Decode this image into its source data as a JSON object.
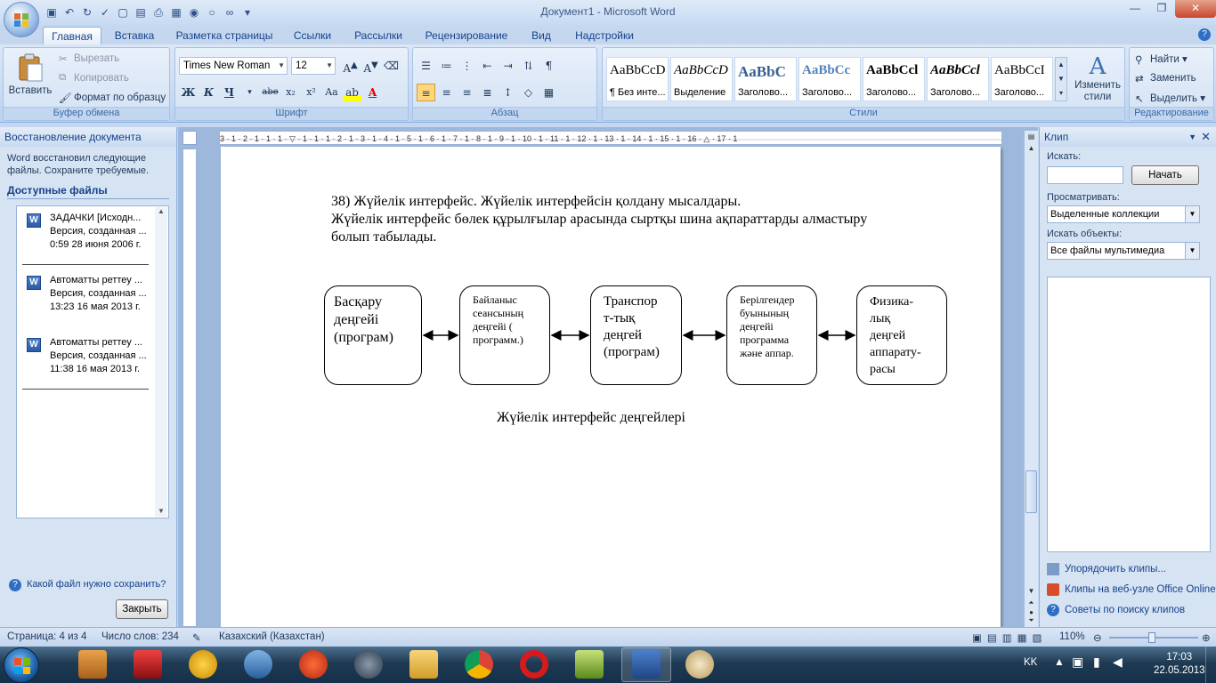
{
  "window": {
    "title": "Документ1 - Microsoft Word"
  },
  "tabs": [
    "Главная",
    "Вставка",
    "Разметка страницы",
    "Ссылки",
    "Рассылки",
    "Рецензирование",
    "Вид",
    "Надстройки"
  ],
  "ribbon": {
    "clipboard": {
      "paste": "Вставить",
      "cut": "Вырезать",
      "copy": "Копировать",
      "format_painter": "Формат по образцу",
      "label": "Буфер обмена"
    },
    "font": {
      "name": "Times New Roman",
      "size": "12",
      "bold": "Ж",
      "italic": "К",
      "underline": "Ч",
      "strike": "abe",
      "sub": "x₂",
      "sup": "x²",
      "case": "Aa",
      "label": "Шрифт"
    },
    "paragraph": {
      "label": "Абзац"
    },
    "styles": {
      "items": [
        {
          "preview": "AaBbCcD",
          "name": "¶ Без инте..."
        },
        {
          "preview": "AaBbCcD",
          "name": "Выделение"
        },
        {
          "preview": "AaBbC",
          "name": "Заголово..."
        },
        {
          "preview": "AaBbCc",
          "name": "Заголово..."
        },
        {
          "preview": "AaBbCcl",
          "name": "Заголово..."
        },
        {
          "preview": "AaBbCcl",
          "name": "Заголово..."
        },
        {
          "preview": "AaBbCcI",
          "name": "Заголово..."
        }
      ],
      "change": "Изменить стили",
      "label": "Стили"
    },
    "editing": {
      "find": "Найти",
      "replace": "Заменить",
      "select": "Выделить",
      "label": "Редактирование"
    }
  },
  "recovery": {
    "title": "Восстановление документа",
    "message": "Word восстановил следующие файлы.  Сохраните требуемые.",
    "available": "Доступные файлы",
    "files": [
      {
        "name": "ЗАДАЧКИ  [Исходн...",
        "line2": "Версия, созданная ...",
        "line3": "0:59 28 июня 2006 г."
      },
      {
        "name": "Автоматты реттеу ...",
        "line2": "Версия, созданная ...",
        "line3": "13:23 16 мая 2013 г."
      },
      {
        "name": "Автоматты реттеу ...",
        "line2": "Версия, созданная ...",
        "line3": "11:38 16 мая 2013 г."
      }
    ],
    "question": "Какой файл нужно сохранить?",
    "close": "Закрыть"
  },
  "document": {
    "line1": "38) Жүйелік интерфейс. Жүйелік интерфейсін қолдану мысалдары.",
    "line2": "Жүйелік интерфейс бөлек құрылғылар арасында сыртқы шина ақпараттарды алмастыру",
    "line3": "болып табылады.",
    "boxes": [
      {
        "l1": "Басқару",
        "l2": "деңгейі",
        "l3": "(програм)"
      },
      {
        "l1": "Байланыс",
        "l2": "сеансының",
        "l3": "деңгейі (",
        "l4": "программ.)"
      },
      {
        "l1": "Транспор",
        "l2": "т-тық",
        "l3": "деңгей",
        "l4": "(програм)"
      },
      {
        "l1": "Берілгендер",
        "l2": "буынының",
        "l3": "деңгейі",
        "l4": "программа",
        "l5": "және аппар."
      },
      {
        "l1": "Физика-",
        "l2": "лық",
        "l3": "деңгей",
        "l4": "аппарату-",
        "l5": "расы"
      }
    ],
    "caption": "Жүйелік интерфейс деңгейлері"
  },
  "clip": {
    "title": "Клип",
    "search_label": "Искать:",
    "start": "Начать",
    "browse_label": "Просматривать:",
    "browse_value": "Выделенные коллекции",
    "find_label": "Искать объекты:",
    "find_value": "Все файлы мультимедиа",
    "links": [
      "Упорядочить клипы...",
      "Клипы на веб-узле Office Online",
      "Советы по поиску клипов"
    ]
  },
  "status": {
    "page": "Страница: 4 из 4",
    "words": "Число слов: 234",
    "lang": "Казахский (Казахстан)",
    "zoom": "110%"
  },
  "tray": {
    "lang": "KK",
    "time": "17:03",
    "date": "22.05.2013"
  }
}
